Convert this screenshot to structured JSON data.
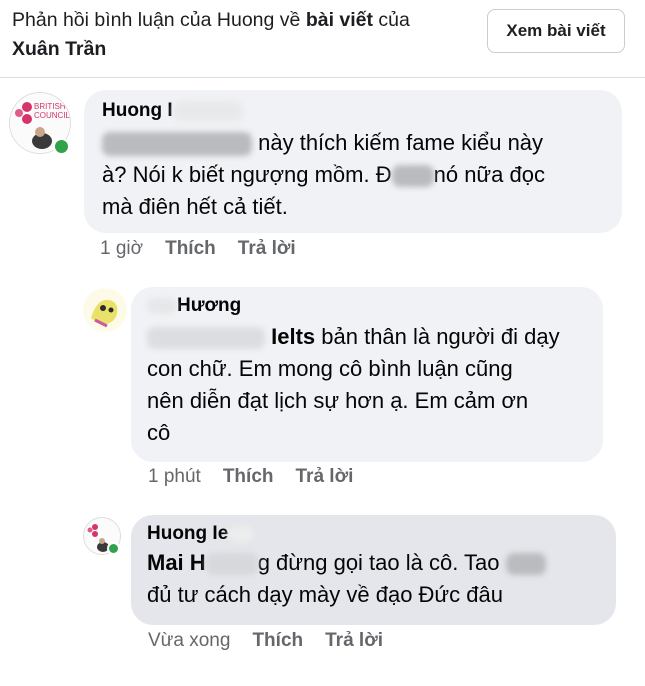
{
  "header": {
    "title_part1": "Phản hồi bình luận của Huong về ",
    "title_bold1": "bài viết",
    "title_part2": " của",
    "title_bold2": "Xuân Trần",
    "view_post_label": "Xem bài viết"
  },
  "comments": [
    {
      "author": "Huong I",
      "avatar_logo_text": [
        "BRITISH",
        "COUNCIL"
      ],
      "line1": "này thích kiếm fame kiểu này",
      "line2_a": "à? Nói k biết ngượng mồm. Đ",
      "line2_b": "nó nữa đọc",
      "line3": "mà điên hết cả tiết.",
      "time": "1 giờ",
      "like": "Thích",
      "reply": "Trả lời"
    },
    {
      "author": "Hương",
      "line1_bold": "Ielts",
      "line1": " bản thân là người đi dạy",
      "line2": "con chữ. Em mong cô bình luận cũng",
      "line3": "nên diễn đạt lịch sự hơn ạ. Em cảm ơn",
      "line4": "cô",
      "time": "1 phút",
      "like": "Thích",
      "reply": "Trả lời"
    },
    {
      "author": "Huong Ie",
      "line1_a": "Mai H",
      "line1_b": "g đừng gọi tao là cô. Tao",
      "line2": "đủ tư cách dạy mày về đạo Đức đâu",
      "time": "Vừa xong",
      "like": "Thích",
      "reply": "Trả lời"
    }
  ],
  "colors": {
    "bubble_light": "#f0f2f5",
    "bubble_dark": "#e4e6eb",
    "meta_text": "#65676b",
    "online": "#31a24c"
  }
}
